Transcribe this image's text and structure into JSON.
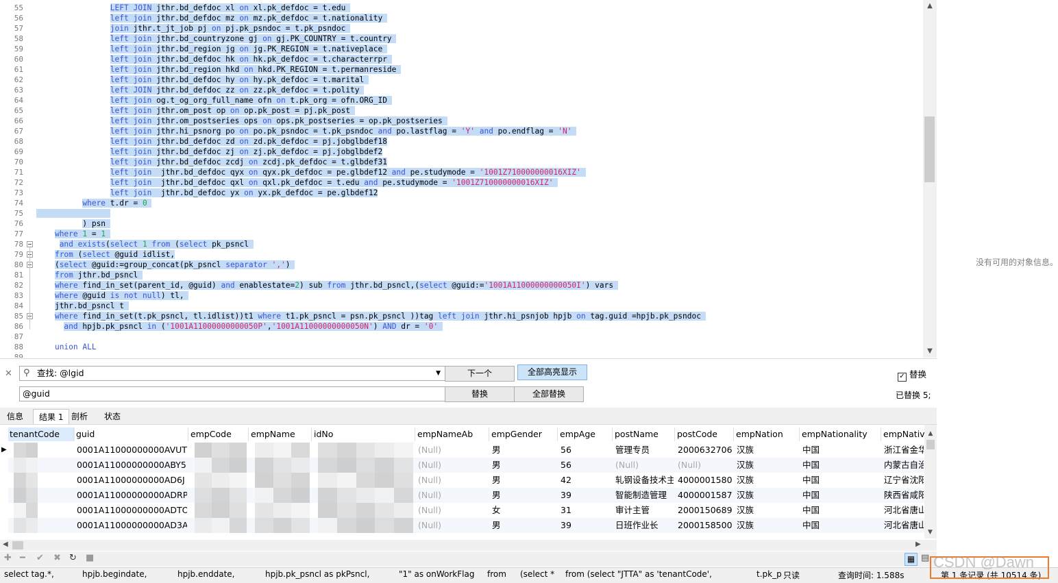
{
  "editor": {
    "lines": [
      {
        "n": "55",
        "html": "                <span class=\"sel\"><span class=\"kw\">LEFT JOIN</span> jthr.bd_defdoc xl <span class=\"kw\">on</span> xl.pk_defdoc = t.edu </span>"
      },
      {
        "n": "56",
        "html": "                <span class=\"sel\"><span class=\"kw\">left join</span> jthr.bd_defdoc mz <span class=\"kw\">on</span> mz.pk_defdoc = t.nationality </span>"
      },
      {
        "n": "57",
        "html": "                <span class=\"sel\"><span class=\"kw\">join</span> jthr.t_jt_job pj <span class=\"kw\">on</span> pj.pk_psndoc = t.pk_psndoc </span>"
      },
      {
        "n": "58",
        "html": "                <span class=\"sel\"><span class=\"kw\">left join</span> jthr.bd_countryzone gj <span class=\"kw\">on</span> gj.PK_COUNTRY = t.country </span>"
      },
      {
        "n": "59",
        "html": "                <span class=\"sel\"><span class=\"kw\">left join</span> jthr.bd_region jg <span class=\"kw\">on</span> jg.PK_REGION = t.nativeplace </span>"
      },
      {
        "n": "60",
        "html": "                <span class=\"sel\"><span class=\"kw\">left join</span> jthr.bd_defdoc hk <span class=\"kw\">on</span> hk.pk_defdoc = t.characterrpr </span>"
      },
      {
        "n": "61",
        "html": "                <span class=\"sel\"><span class=\"kw\">left join</span> jthr.bd_region hkd <span class=\"kw\">on</span> hkd.PK_REGION = t.permanreside </span>"
      },
      {
        "n": "62",
        "html": "                <span class=\"sel\"><span class=\"kw\">left join</span> jthr.bd_defdoc hy <span class=\"kw\">on</span> hy.pk_defdoc = t.marital </span>"
      },
      {
        "n": "63",
        "html": "                <span class=\"sel\"><span class=\"kw\">left JOIN</span> jthr.bd_defdoc zz <span class=\"kw\">on</span> zz.pk_defdoc = t.polity </span>"
      },
      {
        "n": "64",
        "html": "                <span class=\"sel\"><span class=\"kw\">left join</span> og.t_og_org_full_name ofn <span class=\"kw\">on</span> t.pk_org = ofn.ORG_ID </span>"
      },
      {
        "n": "65",
        "html": "                <span class=\"sel\"><span class=\"kw\">left join</span> jthr.om_post op <span class=\"kw\">on</span> op.pk_post = pj.pk_post </span>"
      },
      {
        "n": "66",
        "html": "                <span class=\"sel\"><span class=\"kw\">left join</span> jthr.om_postseries ops <span class=\"kw\">on</span> ops.pk_postseries = op.pk_postseries </span>"
      },
      {
        "n": "67",
        "html": "                <span class=\"sel\"><span class=\"kw\">left join</span> jthr.hi_psnorg po <span class=\"kw\">on</span> po.pk_psndoc = t.pk_psndoc <span class=\"kw\">and</span> po.lastflag = <span class=\"str\">'Y'</span> <span class=\"kw\">and</span> po.endflag = <span class=\"str\">'N'</span> </span>"
      },
      {
        "n": "68",
        "html": "                <span class=\"sel\"><span class=\"kw\">left join</span> jthr.bd_defdoc zd <span class=\"kw\">on</span> zd.pk_defdoc = pj.jobglbdef18</span>"
      },
      {
        "n": "69",
        "html": "                <span class=\"sel\"><span class=\"kw\">left join</span> jthr.bd_defdoc zj <span class=\"kw\">on</span> zj.pk_defdoc = pj.jobglbdef2</span>"
      },
      {
        "n": "70",
        "html": "                <span class=\"sel\"><span class=\"kw\">left join</span> jthr.bd_defdoc zcdj <span class=\"kw\">on</span> zcdj.pk_defdoc = t.glbdef31</span>"
      },
      {
        "n": "71",
        "html": "                <span class=\"sel\"><span class=\"kw\">left join</span>  jthr.bd_defdoc qyx <span class=\"kw\">on</span> qyx.pk_defdoc = pe.glbdef12 <span class=\"kw\">and</span> pe.studymode = <span class=\"str\">'1001Z710000000016XIZ'</span> </span>"
      },
      {
        "n": "72",
        "html": "                <span class=\"sel\"><span class=\"kw\">left join</span>  jthr.bd_defdoc qxl <span class=\"kw\">on</span> qxl.pk_defdoc = t.edu <span class=\"kw\">and</span> pe.studymode = <span class=\"str\">'1001Z710000000016XIZ'</span> </span>"
      },
      {
        "n": "73",
        "html": "                <span class=\"sel\"><span class=\"kw\">left join</span>  jthr.bd_defdoc yx <span class=\"kw\">on</span> yx.pk_defdoc = pe.glbdef12</span>"
      },
      {
        "n": "74",
        "html": "          <span class=\"sel\"><span class=\"kw\">where</span> t.dr = <span class=\"num\">0</span> </span>"
      },
      {
        "n": "75",
        "html": "<span class=\"sel\">                </span>"
      },
      {
        "n": "76",
        "html": "          <span class=\"sel\">) psn </span>"
      },
      {
        "n": "77",
        "html": "    <span class=\"sel\"><span class=\"kw\">where</span> <span class=\"num\">1</span> = <span class=\"num\">1</span> </span>"
      },
      {
        "n": "78",
        "html": "     <span class=\"sel\"><span class=\"kw\">and exists</span>(<span class=\"kw\">select</span> <span class=\"num\">1</span> <span class=\"kw\">from</span> (<span class=\"kw\">select</span> pk_psncl </span>"
      },
      {
        "n": "79",
        "html": "    <span class=\"sel\"><span class=\"kw\">from</span> (<span class=\"kw\">select</span> @guid idlist,</span>"
      },
      {
        "n": "80",
        "html": "    <span class=\"sel\">(<span class=\"kw\">select</span> @guid:=group_concat(pk_psncl <span class=\"kw\">separator</span> <span class=\"str\">','</span>) </span>"
      },
      {
        "n": "81",
        "html": "    <span class=\"sel\"><span class=\"kw\">from</span> jthr.bd_psncl </span>"
      },
      {
        "n": "82",
        "html": "    <span class=\"sel\"><span class=\"kw\">where</span> find_in_set(parent_id, @guid) <span class=\"kw\">and</span> enablestate=<span class=\"num\">2</span>) sub <span class=\"kw\">from</span> jthr.bd_psncl,(<span class=\"kw\">select</span> @guid:=<span class=\"str\">'1001A11000000000050I'</span>) vars </span>"
      },
      {
        "n": "83",
        "html": "    <span class=\"sel\"><span class=\"kw\">where</span> @guid <span class=\"kw\">is not null</span>) tl, </span>"
      },
      {
        "n": "84",
        "html": "    <span class=\"sel\">jthr.bd_psncl t </span>"
      },
      {
        "n": "85",
        "html": "    <span class=\"sel\"><span class=\"kw\">where</span> find_in_set(t.pk_psncl, tl.idlist))t1 <span class=\"kw\">where</span> t1.pk_psncl = psn.pk_psncl ))tag <span class=\"kw\">left join</span> jthr.hi_psnjob hpjb <span class=\"kw\">on</span> tag.guid =hpjb.pk_psndoc </span>"
      },
      {
        "n": "86",
        "html": "      <span class=\"sel\"><span class=\"kw\">and</span> hpjb.pk_psncl <span class=\"kw\">in</span> (<span class=\"str\">'1001A11000000000050P'</span>,<span class=\"str\">'1001A11000000000050N'</span>) <span class=\"kw\">AND</span> dr = <span class=\"str\">'0'</span> </span>"
      },
      {
        "n": "87",
        "html": ""
      },
      {
        "n": "88",
        "html": "    <span class=\"kw\">union ALL</span>"
      },
      {
        "n": "89",
        "html": ""
      }
    ]
  },
  "right_panel": {
    "no_info": "没有可用的对象信息。"
  },
  "find": {
    "search_value": "查找: @lgid",
    "replace_value": "@guid",
    "next_label": "下一个",
    "highlight_all_label": "全部高亮显示",
    "replace_label": "替换",
    "replace_all_label": "全部替换",
    "replace_check_label": "替换",
    "replaced_count": "已替换 5;"
  },
  "tabs": [
    "信息",
    "结果 1",
    "剖析",
    "状态"
  ],
  "grid": {
    "columns": [
      "tenantCode",
      "guid",
      "empCode",
      "empName",
      "idNo",
      "empNameAb",
      "empGender",
      "empAge",
      "postName",
      "postCode",
      "empNation",
      "empNationality",
      "empNativ"
    ],
    "rows": [
      {
        "guid": "0001A11000000000AVUT",
        "nameab": "(Null)",
        "gender": "男",
        "age": "56",
        "post": "管理专员",
        "postcode": "20006327065",
        "nation": "汉族",
        "nationality": "中国",
        "native": "浙江省金华"
      },
      {
        "guid": "0001A11000000000ABY5",
        "nameab": "(Null)",
        "gender": "男",
        "age": "56",
        "post": "(Null)",
        "postcode": "(Null)",
        "nation": "汉族",
        "nationality": "中国",
        "native": "内蒙古自治"
      },
      {
        "guid": "0001A11000000000AD6J",
        "nameab": "(Null)",
        "gender": "男",
        "age": "42",
        "post": "轧钢设备技术主管",
        "postcode": "40000015801",
        "nation": "汉族",
        "nationality": "中国",
        "native": "辽宁省沈阳"
      },
      {
        "guid": "0001A11000000000ADRP",
        "nameab": "(Null)",
        "gender": "男",
        "age": "39",
        "post": "智能制造管理",
        "postcode": "40000015872",
        "nation": "汉族",
        "nationality": "中国",
        "native": "陕西省咸阳"
      },
      {
        "guid": "0001A11000000000ADTO",
        "nameab": "(Null)",
        "gender": "女",
        "age": "31",
        "post": "审计主管",
        "postcode": "20001506899",
        "nation": "汉族",
        "nationality": "中国",
        "native": "河北省唐山"
      },
      {
        "guid": "0001A11000000000AD3A",
        "nameab": "(Null)",
        "gender": "男",
        "age": "39",
        "post": "日班作业长",
        "postcode": "20001585001",
        "nation": "汉族",
        "nationality": "中国",
        "native": "河北省唐山"
      }
    ]
  },
  "status": {
    "sql_preview": [
      "select tag.*,",
      "hpjb.begindate,",
      "hpjb.enddate,",
      "hpjb.pk_psncl as pkPsncl,",
      "\"1\" as onWorkFlag",
      "from",
      "(select *",
      "from (select \"JTTA\" as 'tenantCode',",
      "t.pk_p"
    ],
    "readonly": "只读",
    "query_time": "查询时间: 1.588s",
    "records": "第 1 条记录 (共 10514 条)"
  },
  "watermark": "CSDN @Dawn"
}
